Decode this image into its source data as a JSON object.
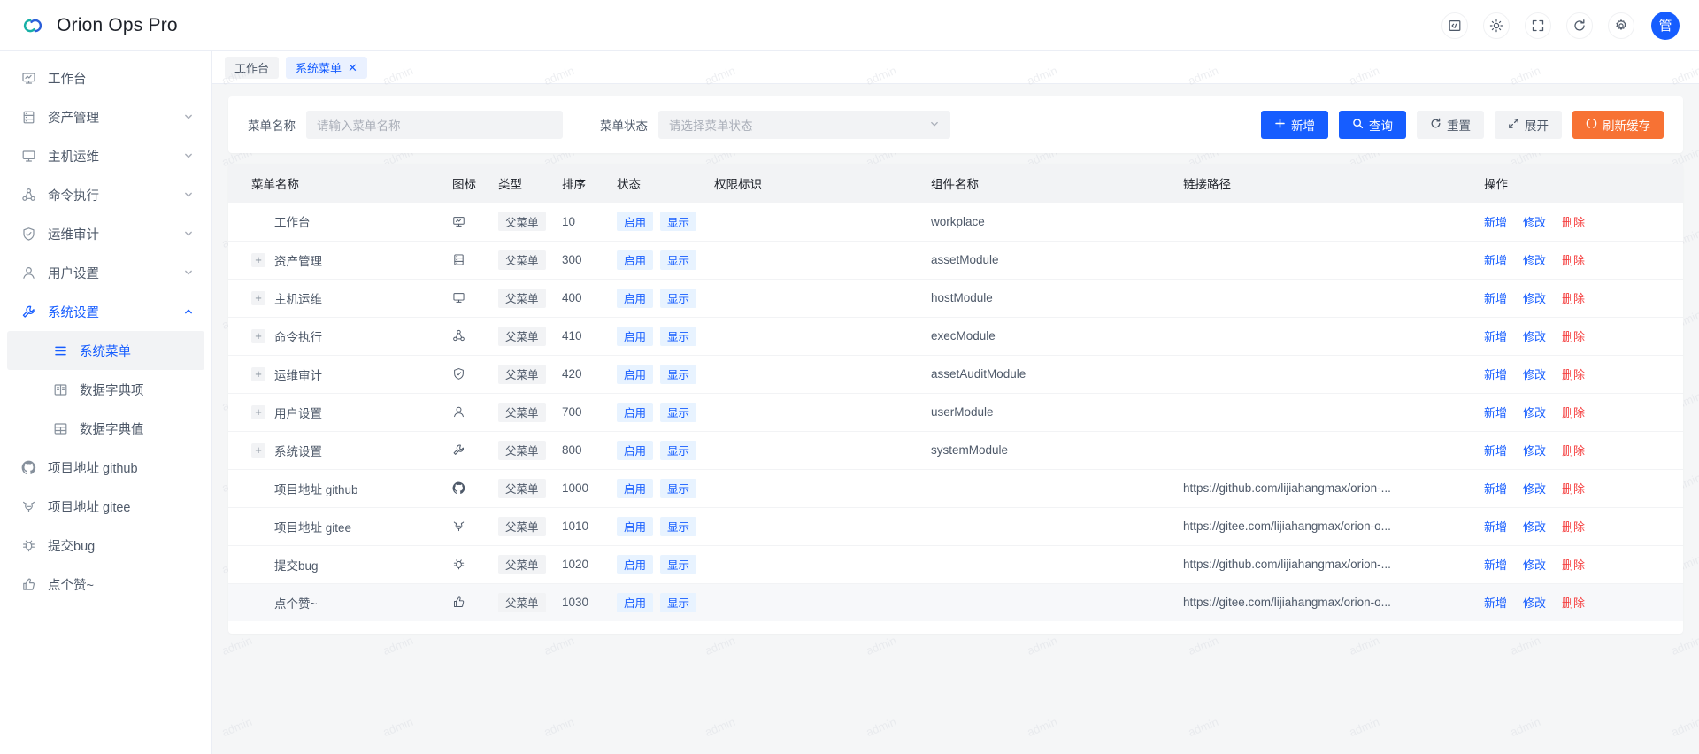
{
  "app": {
    "brand_title": "Orion Ops Pro",
    "logo_icon": "orion-link-logo"
  },
  "header": {
    "tools": [
      {
        "name": "code-icon",
        "glyph": "code"
      },
      {
        "name": "brightness-icon",
        "glyph": "brightness"
      },
      {
        "name": "fullscreen-icon",
        "glyph": "fullscreen"
      },
      {
        "name": "refresh-icon",
        "glyph": "refresh"
      },
      {
        "name": "gear-icon",
        "glyph": "gear"
      }
    ],
    "avatar_text": "管",
    "avatar_color": "#165dff"
  },
  "sidebar": {
    "items": [
      {
        "label": "工作台",
        "icon": "workbench-icon",
        "arrow": "",
        "active": false
      },
      {
        "label": "资产管理",
        "icon": "asset-icon",
        "arrow": "down",
        "active": false
      },
      {
        "label": "主机运维",
        "icon": "host-icon",
        "arrow": "down",
        "active": false
      },
      {
        "label": "命令执行",
        "icon": "exec-icon",
        "arrow": "down",
        "active": false
      },
      {
        "label": "运维审计",
        "icon": "shield-icon",
        "arrow": "down",
        "active": false
      },
      {
        "label": "用户设置",
        "icon": "user-icon",
        "arrow": "down",
        "active": false
      },
      {
        "label": "系统设置",
        "icon": "wrench-icon",
        "arrow": "up",
        "active": true
      }
    ],
    "subitems": [
      {
        "label": "系统菜单",
        "icon": "menu-list-icon",
        "selected": true
      },
      {
        "label": "数据字典项",
        "icon": "book-icon",
        "selected": false
      },
      {
        "label": "数据字典值",
        "icon": "table-icon",
        "selected": false
      }
    ],
    "links": [
      {
        "label": "项目地址 github",
        "icon": "github-icon"
      },
      {
        "label": "项目地址 gitee",
        "icon": "gitee-icon"
      },
      {
        "label": "提交bug",
        "icon": "bug-icon"
      },
      {
        "label": "点个赞~",
        "icon": "thumbup-icon"
      }
    ]
  },
  "tabs": [
    {
      "label": "工作台",
      "active": false,
      "closable": false
    },
    {
      "label": "系统菜单",
      "active": true,
      "closable": true,
      "close_glyph": "✕"
    }
  ],
  "search": {
    "name_label": "菜单名称",
    "name_placeholder": "请输入菜单名称",
    "name_value": "",
    "status_label": "菜单状态",
    "status_placeholder": "请选择菜单状态",
    "status_value": "",
    "buttons": [
      {
        "label": "新增",
        "style": "primary",
        "icon": "plus-icon"
      },
      {
        "label": "查询",
        "style": "primary",
        "icon": "search-icon"
      },
      {
        "label": "重置",
        "style": "default",
        "icon": "reset-icon"
      },
      {
        "label": "展开",
        "style": "default",
        "icon": "expand-icon"
      },
      {
        "label": "刷新缓存",
        "style": "warning",
        "icon": "cache-icon"
      }
    ]
  },
  "table": {
    "headers": [
      "菜单名称",
      "图标",
      "类型",
      "排序",
      "状态",
      "权限标识",
      "组件名称",
      "链接路径",
      "操作"
    ],
    "ops_labels": {
      "add": "新增",
      "edit": "修改",
      "delete": "删除"
    },
    "rows": [
      {
        "name": "工作台",
        "expandable": false,
        "icon": "workbench-icon",
        "type": "父菜单",
        "order": "10",
        "status": "启用",
        "visible": "显示",
        "perm": "",
        "component": "workplace",
        "path": "",
        "hover": false
      },
      {
        "name": "资产管理",
        "expandable": true,
        "icon": "asset-icon",
        "type": "父菜单",
        "order": "300",
        "status": "启用",
        "visible": "显示",
        "perm": "",
        "component": "assetModule",
        "path": "",
        "hover": false
      },
      {
        "name": "主机运维",
        "expandable": true,
        "icon": "host-icon",
        "type": "父菜单",
        "order": "400",
        "status": "启用",
        "visible": "显示",
        "perm": "",
        "component": "hostModule",
        "path": "",
        "hover": false
      },
      {
        "name": "命令执行",
        "expandable": true,
        "icon": "exec-icon",
        "type": "父菜单",
        "order": "410",
        "status": "启用",
        "visible": "显示",
        "perm": "",
        "component": "execModule",
        "path": "",
        "hover": false
      },
      {
        "name": "运维审计",
        "expandable": true,
        "icon": "shield-icon",
        "type": "父菜单",
        "order": "420",
        "status": "启用",
        "visible": "显示",
        "perm": "",
        "component": "assetAuditModule",
        "path": "",
        "hover": false
      },
      {
        "name": "用户设置",
        "expandable": true,
        "icon": "user-icon",
        "type": "父菜单",
        "order": "700",
        "status": "启用",
        "visible": "显示",
        "perm": "",
        "component": "userModule",
        "path": "",
        "hover": false
      },
      {
        "name": "系统设置",
        "expandable": true,
        "icon": "wrench-icon",
        "type": "父菜单",
        "order": "800",
        "status": "启用",
        "visible": "显示",
        "perm": "",
        "component": "systemModule",
        "path": "",
        "hover": false
      },
      {
        "name": "项目地址 github",
        "expandable": false,
        "icon": "github-icon",
        "type": "父菜单",
        "order": "1000",
        "status": "启用",
        "visible": "显示",
        "perm": "",
        "component": "",
        "path": "https://github.com/lijiahangmax/orion-...",
        "hover": false
      },
      {
        "name": "项目地址 gitee",
        "expandable": false,
        "icon": "gitee-icon",
        "type": "父菜单",
        "order": "1010",
        "status": "启用",
        "visible": "显示",
        "perm": "",
        "component": "",
        "path": "https://gitee.com/lijiahangmax/orion-o...",
        "hover": false
      },
      {
        "name": "提交bug",
        "expandable": false,
        "icon": "bug-icon",
        "type": "父菜单",
        "order": "1020",
        "status": "启用",
        "visible": "显示",
        "perm": "",
        "component": "",
        "path": "https://github.com/lijiahangmax/orion-...",
        "hover": false
      },
      {
        "name": "点个赞~",
        "expandable": false,
        "icon": "thumbup-icon",
        "type": "父菜单",
        "order": "1030",
        "status": "启用",
        "visible": "显示",
        "perm": "",
        "component": "",
        "path": "https://gitee.com/lijiahangmax/orion-o...",
        "hover": true
      }
    ]
  },
  "watermark": {
    "text": "admin"
  },
  "colors": {
    "primary": "#165dff",
    "warning": "#f77234",
    "danger": "#f53f3f",
    "tag_blue_bg": "#e8f3ff",
    "tag_gray_bg": "#f2f3f5",
    "content_bg": "#f5f6f7"
  }
}
